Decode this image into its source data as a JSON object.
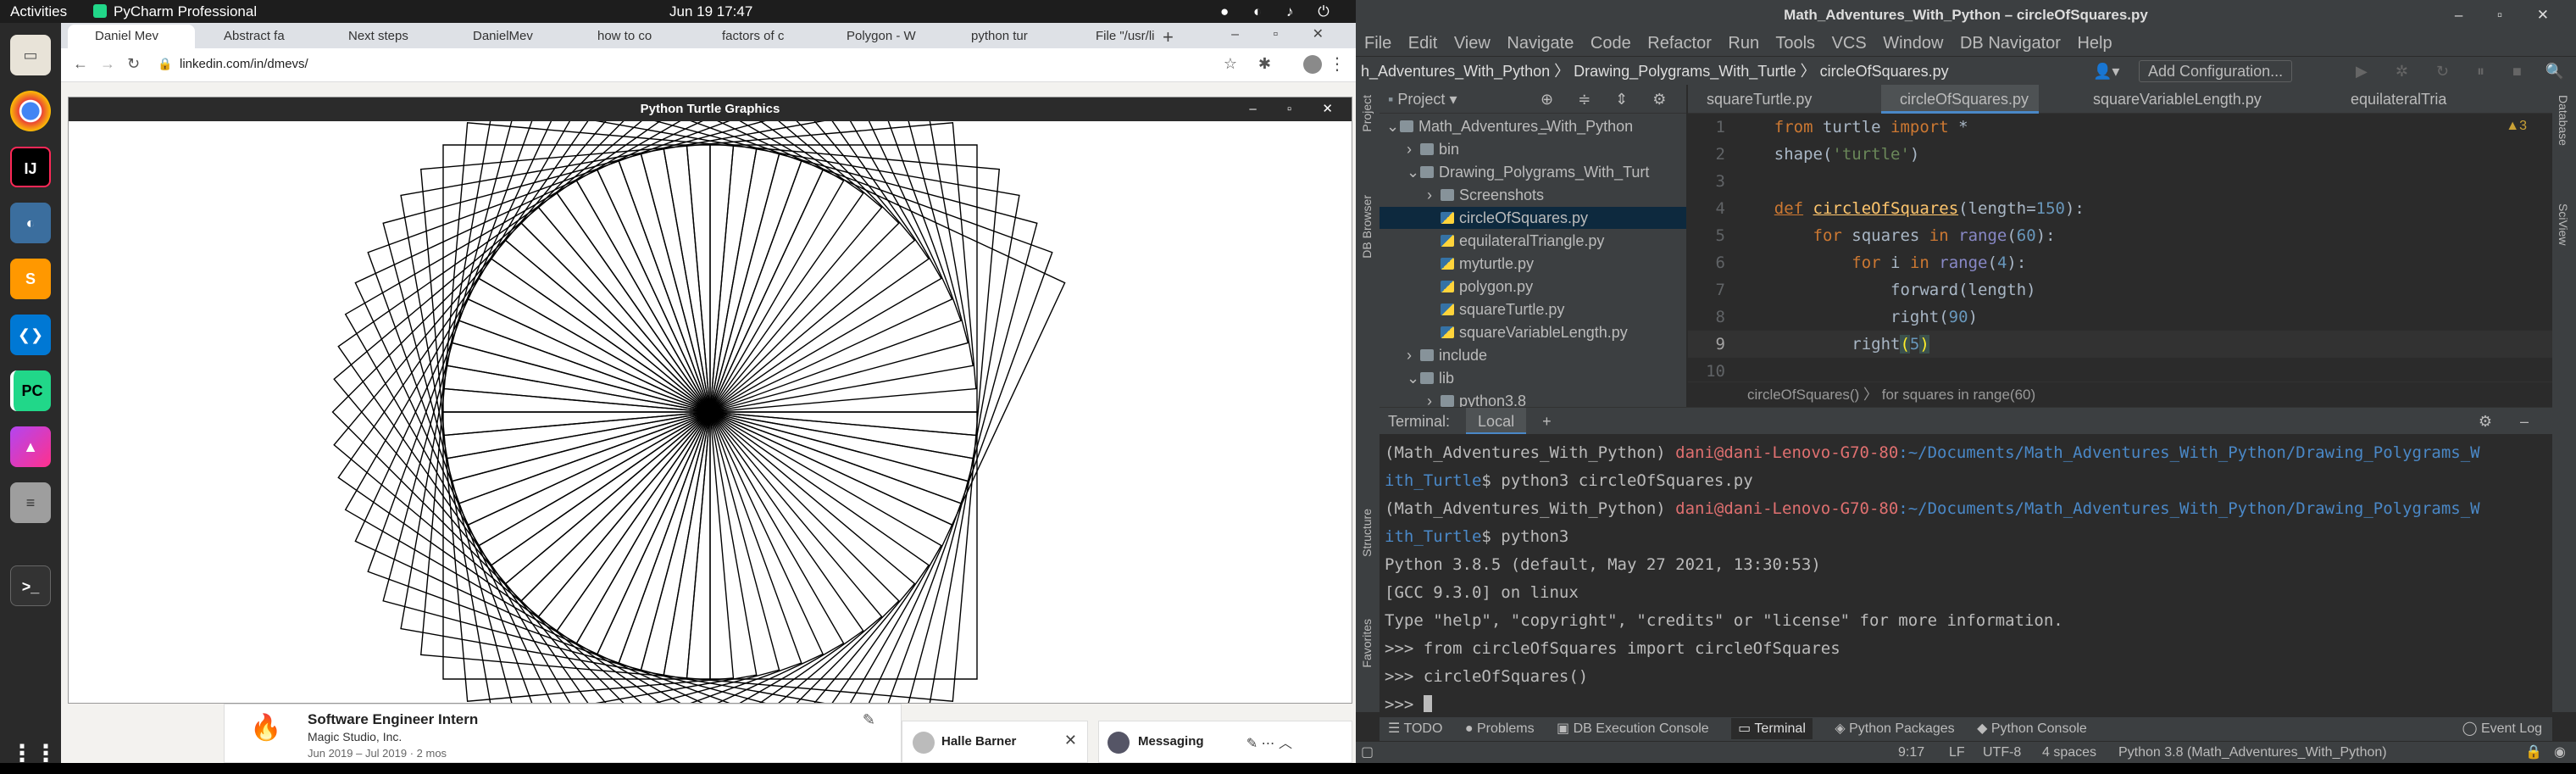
{
  "topbar": {
    "activities": "Activities",
    "app_menu": "PyCharm Professional",
    "clock": "Jun 19  17:47"
  },
  "dock": {
    "items": [
      "files-icon",
      "chrome-icon",
      "intellij-icon",
      "dbeaver-icon",
      "sublime-icon",
      "vscode-icon",
      "pycharm-icon",
      "phpstorm-icon",
      "database-icon",
      "terminal-icon",
      "apps-grid-icon"
    ]
  },
  "browser": {
    "tabs": [
      "Daniel Mev",
      "Abstract fa",
      "Next steps",
      "DanielMev",
      "how to co",
      "factors of c",
      "Polygon - W",
      "python tur",
      "File \"/usr/li"
    ],
    "url": "linkedin.com/in/dmevs/",
    "linkedin": {
      "job_title": "Software Engineer Intern",
      "company": "Magic Studio, Inc.",
      "dates": "Jun 2019 – Jul 2019 · 2 mos",
      "chat_name": "Halle Barner",
      "messaging": "Messaging"
    }
  },
  "turtle_window": {
    "title": "Python Turtle Graphics",
    "squares": 60,
    "side": 150,
    "turn": 5
  },
  "ide": {
    "title": "Math_Adventures_With_Python – circleOfSquares.py",
    "menu": [
      "File",
      "Edit",
      "View",
      "Navigate",
      "Code",
      "Refactor",
      "Run",
      "Tools",
      "VCS",
      "Window",
      "DB Navigator",
      "Help"
    ],
    "breadcrumb": [
      "h_Adventures_With_Python",
      "Drawing_Polygrams_With_Turtle",
      "circleOfSquares.py"
    ],
    "config_button": "Add Configuration...",
    "project_label": "Project",
    "tree": [
      {
        "label": "Math_Adventures_With_Python",
        "indent": 0,
        "type": "folder-open"
      },
      {
        "label": "bin",
        "indent": 1,
        "type": "folder"
      },
      {
        "label": "Drawing_Polygrams_With_Turt",
        "indent": 1,
        "type": "folder-open"
      },
      {
        "label": "Screenshots",
        "indent": 2,
        "type": "folder"
      },
      {
        "label": "circleOfSquares.py",
        "indent": 2,
        "type": "file",
        "selected": true
      },
      {
        "label": "equilateralTriangle.py",
        "indent": 2,
        "type": "file"
      },
      {
        "label": "myturtle.py",
        "indent": 2,
        "type": "file"
      },
      {
        "label": "polygon.py",
        "indent": 2,
        "type": "file"
      },
      {
        "label": "squareTurtle.py",
        "indent": 2,
        "type": "file"
      },
      {
        "label": "squareVariableLength.py",
        "indent": 2,
        "type": "file"
      },
      {
        "label": "include",
        "indent": 1,
        "type": "folder"
      },
      {
        "label": "lib",
        "indent": 1,
        "type": "folder-open"
      },
      {
        "label": "python3.8",
        "indent": 2,
        "type": "folder"
      }
    ],
    "editor_tabs": [
      "squareTurtle.py",
      "circleOfSquares.py",
      "squareVariableLength.py",
      "equilateralTria"
    ],
    "warnings": "3",
    "code_breadcrumb": [
      "circleOfSquares()",
      "for squares in range(60)"
    ],
    "terminal": {
      "label": "Terminal:",
      "tab": "Local",
      "lines": [
        {
          "env": "(Math_Adventures_With_Python) ",
          "user": "dani@dani-Lenovo-G70-80",
          "path": ":~/Documents/Math_Adventures_With_Python/Drawing_Polygrams_W"
        },
        {
          "path": "ith_Turtle",
          "cmd": "$ python3 circleOfSquares.py"
        },
        {
          "env": "(Math_Adventures_With_Python) ",
          "user": "dani@dani-Lenovo-G70-80",
          "path": ":~/Documents/Math_Adventures_With_Python/Drawing_Polygrams_W"
        },
        {
          "path": "ith_Turtle",
          "cmd": "$ python3"
        },
        {
          "text": "Python 3.8.5 (default, May 27 2021, 13:30:53)"
        },
        {
          "text": "[GCC 9.3.0] on linux"
        },
        {
          "text": "Type \"help\", \"copyright\", \"credits\" or \"license\" for more information."
        },
        {
          "text": ">>> from circleOfSquares import circleOfSquares"
        },
        {
          "text": ">>> circleOfSquares()"
        },
        {
          "text": ">>> "
        }
      ]
    },
    "tool_tabs": [
      "TODO",
      "Problems",
      "DB Execution Console",
      "Terminal",
      "Python Packages",
      "Python Console"
    ],
    "event_log": "Event Log",
    "status": {
      "position": "9:17",
      "line_sep": "LF",
      "encoding": "UTF-8",
      "indent": "4 spaces",
      "interpreter": "Python 3.8 (Math_Adventures_With_Python)"
    },
    "left_strip": [
      "Project",
      "DB Browser",
      "Structure",
      "Favorites"
    ],
    "right_strip": [
      "Database",
      "SciView"
    ]
  }
}
